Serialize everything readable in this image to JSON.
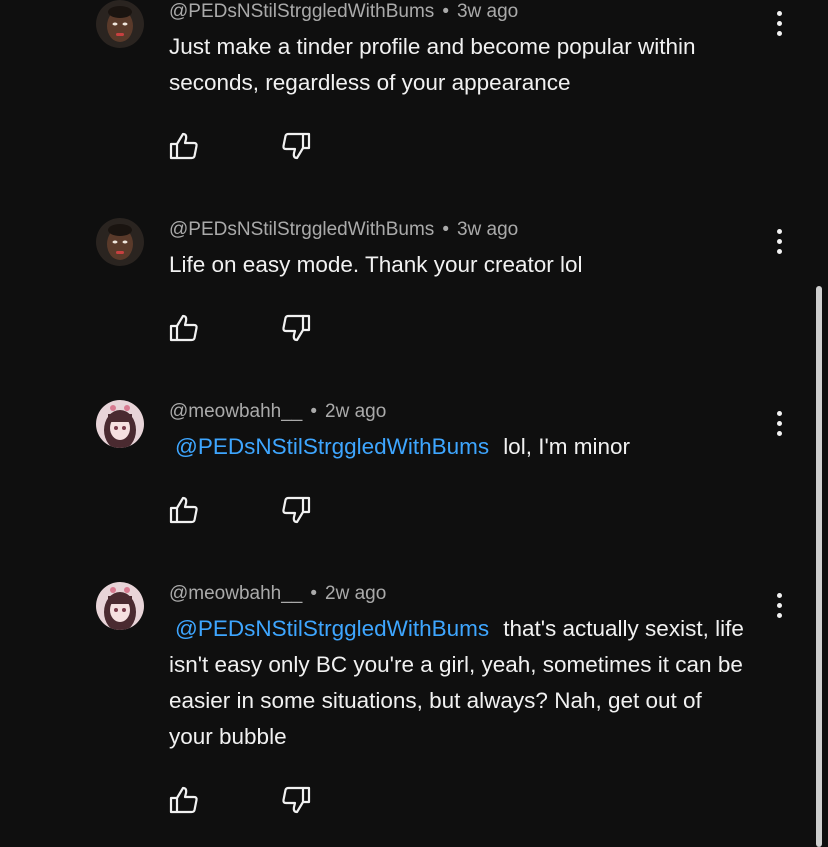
{
  "comments": [
    {
      "author": "@PEDsNStilStrggledWithBums",
      "time": "3w ago",
      "separator": "•",
      "mention": "",
      "text": "Just make a tinder profile and become popular within seconds, regardless of your appearance",
      "avatar_icon": "man-face-avatar"
    },
    {
      "author": "@PEDsNStilStrggledWithBums",
      "time": "3w ago",
      "separator": "•",
      "mention": "",
      "text": "Life on easy mode. Thank your creator lol",
      "avatar_icon": "man-face-avatar"
    },
    {
      "author": "@meowbahh__",
      "time": "2w ago",
      "separator": "•",
      "mention": "@PEDsNStilStrggledWithBums",
      "text": "lol, I'm minor",
      "avatar_icon": "anime-girl-avatar"
    },
    {
      "author": "@meowbahh__",
      "time": "2w ago",
      "separator": "•",
      "mention": "@PEDsNStilStrggledWithBums",
      "text": "that's actually sexist, life isn't easy only BC you're a girl, yeah, sometimes it can be easier in some situations, but always? Nah, get out of your bubble",
      "avatar_icon": "anime-girl-avatar"
    }
  ],
  "colors": {
    "background": "#0f0f0f",
    "text": "#f1f1f1",
    "meta": "#aaaaaa",
    "mention": "#3ea6ff"
  }
}
